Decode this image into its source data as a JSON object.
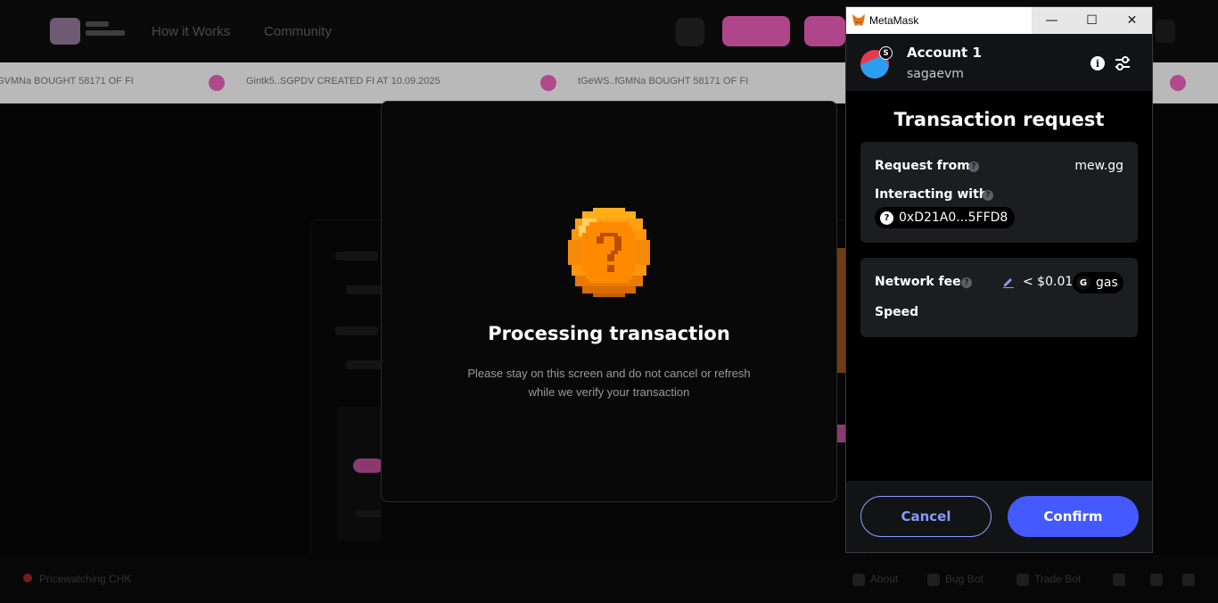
{
  "site": {
    "nav": [
      "How it Works",
      "Community"
    ],
    "ticker": [
      "GVMNa BOUGHT 58171 OF FI",
      "Gintk5..SGPDV CREATED FI AT 10.09.2025",
      "tGeWS..fGMNa BOUGHT 58171 OF FI"
    ],
    "footer_status": "Pricewatching CHK",
    "footer_links": [
      "About",
      "Bug Bot",
      "Trade Bot"
    ]
  },
  "processing": {
    "title": "Processing transaction",
    "subtitle_line1": "Please stay on this screen and do not cancel or refresh",
    "subtitle_line2": "while we verify your transaction",
    "icon": "question-coin-icon"
  },
  "metamask": {
    "window_title": "MetaMask",
    "controls": {
      "minimize": "—",
      "maximize": "☐",
      "close": "✕"
    },
    "account": {
      "name": "Account 1",
      "network": "sagaevm",
      "network_badge": "S"
    },
    "title": "Transaction request",
    "request_from_label": "Request from",
    "request_from_value": "mew.gg",
    "interacting_with_label": "Interacting with",
    "contract_address": "0xD21A0...5FFD8",
    "network_fee_label": "Network fee",
    "network_fee_value": "< $0.01",
    "gas_token_letter": "G",
    "gas_label": "gas",
    "speed_label": "Speed",
    "cancel_label": "Cancel",
    "confirm_label": "Confirm",
    "colors": {
      "accent": "#4459ff",
      "accent_outline": "#8b99ff",
      "card": "#1c1d1f"
    }
  }
}
